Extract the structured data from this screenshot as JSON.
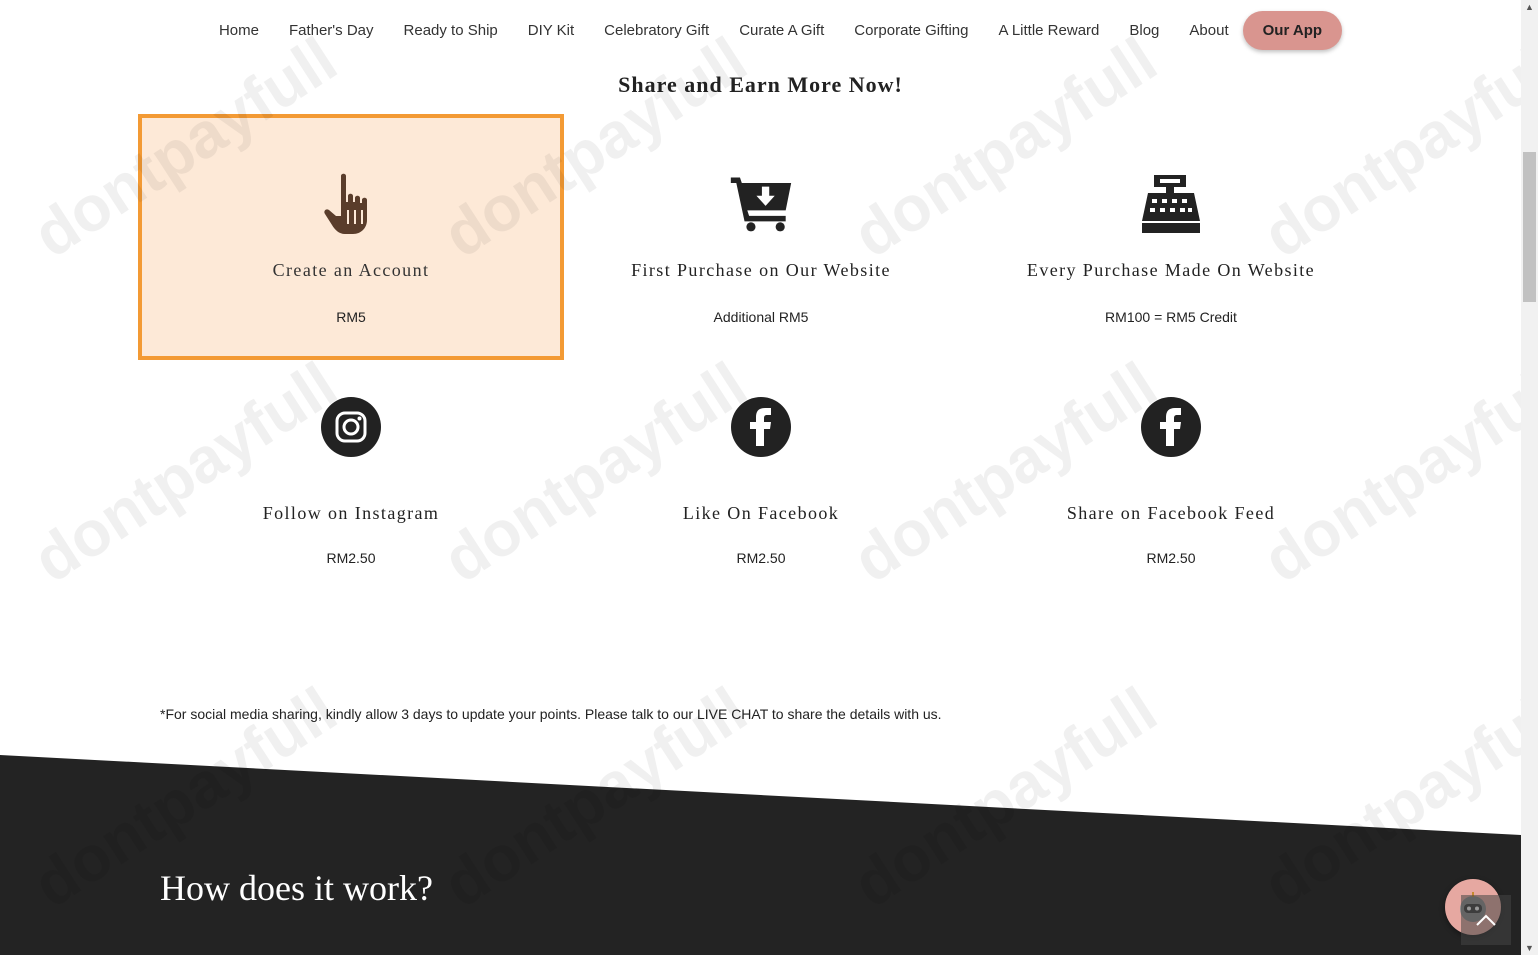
{
  "nav": {
    "items": [
      "Home",
      "Father's Day",
      "Ready to Ship",
      "DIY Kit",
      "Celebratory Gift",
      "Curate A Gift",
      "Corporate Gifting",
      "A Little Reward",
      "Blog",
      "About"
    ],
    "app_button": "Our App"
  },
  "section": {
    "title": "Share and Earn More Now!",
    "cards": [
      {
        "title": "Create an Account",
        "amount": "RM5",
        "icon": "pointing-hand-icon"
      },
      {
        "title": "First Purchase on Our Website",
        "amount": "Additional RM5",
        "icon": "cart-download-icon"
      },
      {
        "title": "Every Purchase Made On Website",
        "amount": "RM100 = RM5 Credit",
        "icon": "cash-register-icon"
      },
      {
        "title": "Follow on Instagram",
        "amount": "RM2.50",
        "icon": "instagram-icon"
      },
      {
        "title": "Like On Facebook",
        "amount": "RM2.50",
        "icon": "facebook-icon"
      },
      {
        "title": "Share on Facebook Feed",
        "amount": "RM2.50",
        "icon": "facebook-icon"
      }
    ],
    "footnote": "*For social media sharing, kindly allow 3 days to update your points. Please talk to our LIVE CHAT to share the details with us."
  },
  "how": {
    "title": "How does it work?"
  },
  "watermark": "dontpayfull",
  "colors": {
    "highlight_bg": "#fde9d7",
    "highlight_border": "#f39a34",
    "dark_band": "#232323",
    "app_button": "#d9958f",
    "icon_dark": "#222222",
    "icon_brown": "#5a3d2b"
  }
}
